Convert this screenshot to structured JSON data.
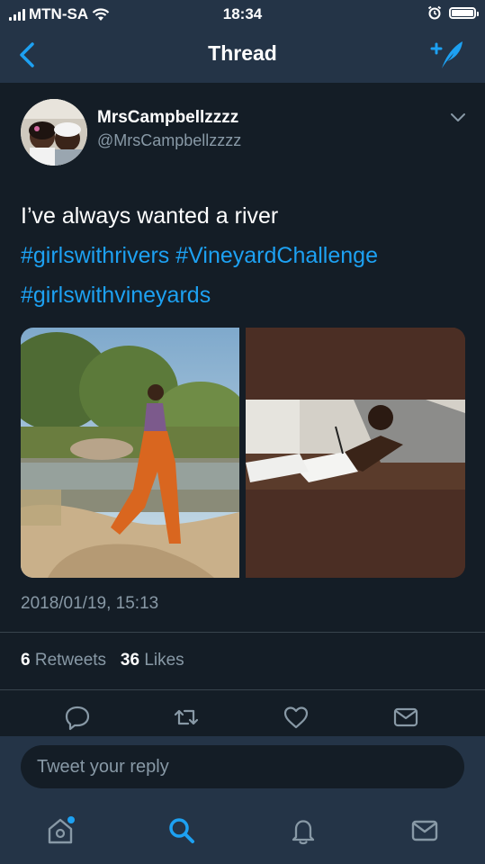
{
  "status": {
    "carrier": "MTN-SA",
    "time": "18:34"
  },
  "nav": {
    "title": "Thread"
  },
  "tweet": {
    "display_name": "MrsCampbellzzzz",
    "handle": "@MrsCampbellzzzz",
    "text": "I’ve always wanted a river",
    "hashtags": [
      "#girlswithrivers",
      "#VineyardChallenge",
      "#girlswithvineyards"
    ],
    "timestamp": "2018/01/19, 15:13",
    "retweets_count": "6",
    "retweets_label": "Retweets",
    "likes_count": "36",
    "likes_label": "Likes"
  },
  "reply": {
    "placeholder": "Tweet your reply"
  },
  "icons": {
    "back": "chevron-left-icon",
    "compose": "compose-tweet-icon",
    "more": "chevron-down-icon",
    "reply": "reply-icon",
    "retweet": "retweet-icon",
    "like": "heart-icon",
    "dm": "envelope-icon",
    "home": "home-icon",
    "search": "search-icon",
    "notifications": "bell-icon",
    "messages": "envelope-icon"
  },
  "colors": {
    "accent": "#1da1f2",
    "background": "#141d26",
    "bar": "#243447",
    "muted": "#8899a6"
  }
}
